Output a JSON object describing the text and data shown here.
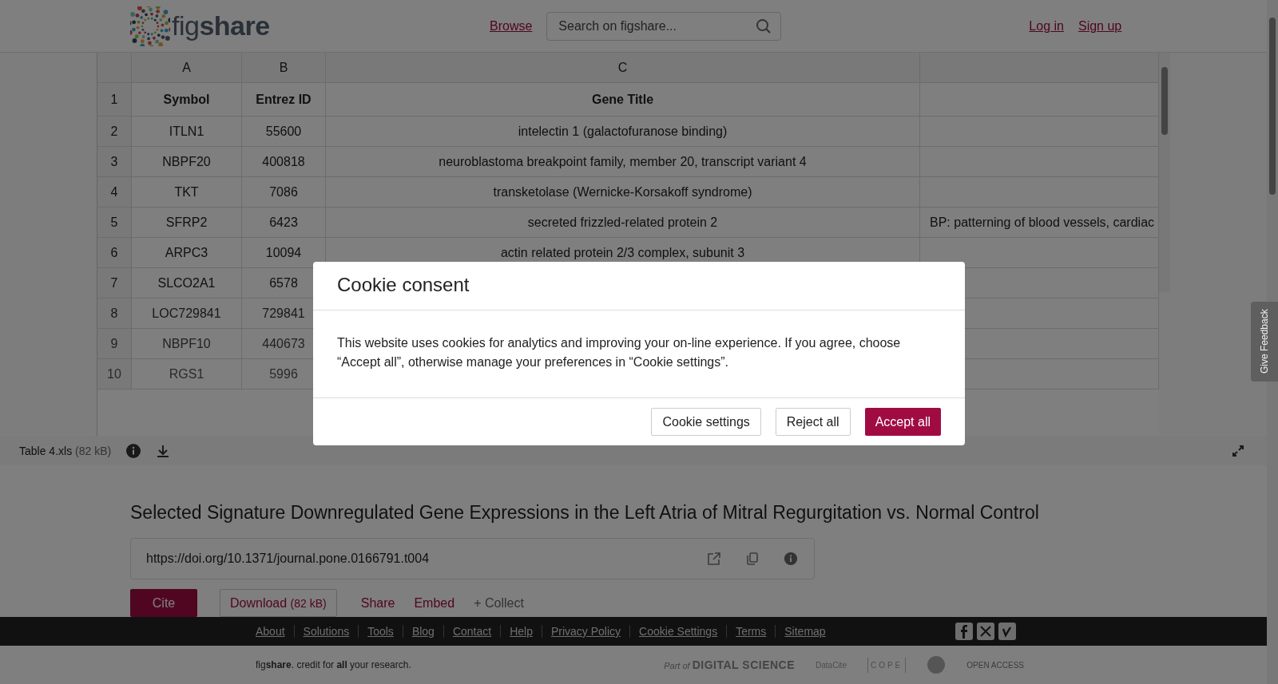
{
  "header": {
    "logo": "fig**share**",
    "nav_link": "Browse",
    "search": {
      "placeholder": "Search on figshare..."
    },
    "auth_links": [
      "Log in",
      "Sign up"
    ]
  },
  "spreadsheet": {
    "columns": [
      "A",
      "B",
      "C",
      ""
    ],
    "rows": [
      {
        "n": "1",
        "cells": [
          "Symbol",
          "Entrez ID",
          "Gene Title",
          ""
        ],
        "bold": true
      },
      {
        "n": "2",
        "cells": [
          "ITLN1",
          "55600",
          "intelectin 1 (galactofuranose binding)",
          ""
        ],
        "bold": false
      },
      {
        "n": "3",
        "cells": [
          "NBPF20",
          "400818",
          "neuroblastoma breakpoint family, member 20, transcript variant 4",
          ""
        ],
        "bold": false
      },
      {
        "n": "4",
        "cells": [
          "TKT",
          "7086",
          "transketolase (Wernicke-Korsakoff syndrome)",
          ""
        ],
        "bold": false
      },
      {
        "n": "5",
        "cells": [
          "SFRP2",
          "6423",
          "secreted frizzled-related protein 2",
          "BP: patterning of blood vessels, cardiac"
        ],
        "bold": false
      },
      {
        "n": "6",
        "cells": [
          "ARPC3",
          "10094",
          "actin related protein 2/3 complex, subunit 3",
          ""
        ],
        "bold": false
      },
      {
        "n": "7",
        "cells": [
          "SLCO2A1",
          "6578",
          "",
          ""
        ],
        "bold": false
      },
      {
        "n": "8",
        "cells": [
          "LOC729841",
          "729841",
          "",
          ""
        ],
        "bold": false
      },
      {
        "n": "9",
        "cells": [
          "NBPF10",
          "440673",
          "",
          ""
        ],
        "bold": false
      },
      {
        "n": "10",
        "cells": [
          "RGS1",
          "5996",
          "",
          ""
        ],
        "bold": false
      }
    ]
  },
  "file_bar": {
    "name": "Table 4.xls",
    "size": "(82 kB)"
  },
  "feedback_tab": "Give Feedback",
  "item": {
    "title": "Selected Signature Downregulated Gene Expressions in the Left Atria of Mitral Regurgitation vs. Normal Control",
    "doi": "https://doi.org/10.1371/journal.pone.0166791.t004",
    "actions": [
      {
        "kind": "primary",
        "label": "Cite"
      },
      {
        "kind": "outline",
        "label": "Download",
        "extra": "(82 kB)"
      },
      {
        "kind": "link",
        "label": "Share"
      },
      {
        "kind": "link",
        "label": "Embed"
      },
      {
        "kind": "muted",
        "label": "+ Collect"
      }
    ]
  },
  "footer": {
    "links": [
      "About",
      "Solutions",
      "Tools",
      "Blog",
      "Contact",
      "Help",
      "Privacy Policy",
      "Cookie Settings",
      "Terms",
      "Sitemap"
    ],
    "tagline": "fig**share**. credit for **all** your research.",
    "partners": [
      "Part of",
      "DIGITAL SCIENCE",
      "DataCite",
      "COPE",
      "OPEN ACCESS"
    ]
  },
  "cookie_dialog": {
    "title": "Cookie consent",
    "body": "This website uses cookies for analytics and improving your on-line experience. If you agree, choose “Accept all”, otherwise manage your preferences in “Cookie settings”.",
    "buttons": [
      {
        "kind": "secondary",
        "label": "Cookie settings"
      },
      {
        "kind": "secondary",
        "label": "Reject all"
      },
      {
        "kind": "primary",
        "label": "Accept all"
      }
    ]
  }
}
